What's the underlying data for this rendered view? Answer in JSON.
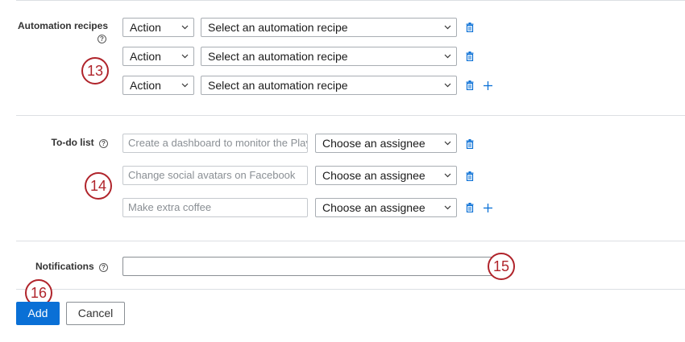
{
  "automation": {
    "label": "Automation recipes",
    "rows": [
      {
        "action": "Action",
        "recipe": "Select an automation recipe"
      },
      {
        "action": "Action",
        "recipe": "Select an automation recipe"
      },
      {
        "action": "Action",
        "recipe": "Select an automation recipe"
      }
    ]
  },
  "todo": {
    "label": "To-do list",
    "rows": [
      {
        "task": "Create a dashboard to monitor the Playb",
        "assignee": "Choose an assignee"
      },
      {
        "task": "Change social avatars on Facebook",
        "assignee": "Choose an assignee"
      },
      {
        "task": "Make extra coffee",
        "assignee": "Choose an assignee"
      }
    ]
  },
  "notifications": {
    "label": "Notifications",
    "value": ""
  },
  "callouts": [
    "13",
    "14",
    "15",
    "16"
  ],
  "buttons": {
    "add": "Add",
    "cancel": "Cancel"
  },
  "help_glyph": "?",
  "icons": {
    "delete": "trash-icon",
    "add": "plus-icon",
    "dropdown": "chevron-down-icon",
    "help": "help-circle-icon"
  },
  "colors": {
    "accent": "#0a70d6",
    "callout": "#b0242b",
    "divider": "#dcdfe3"
  }
}
